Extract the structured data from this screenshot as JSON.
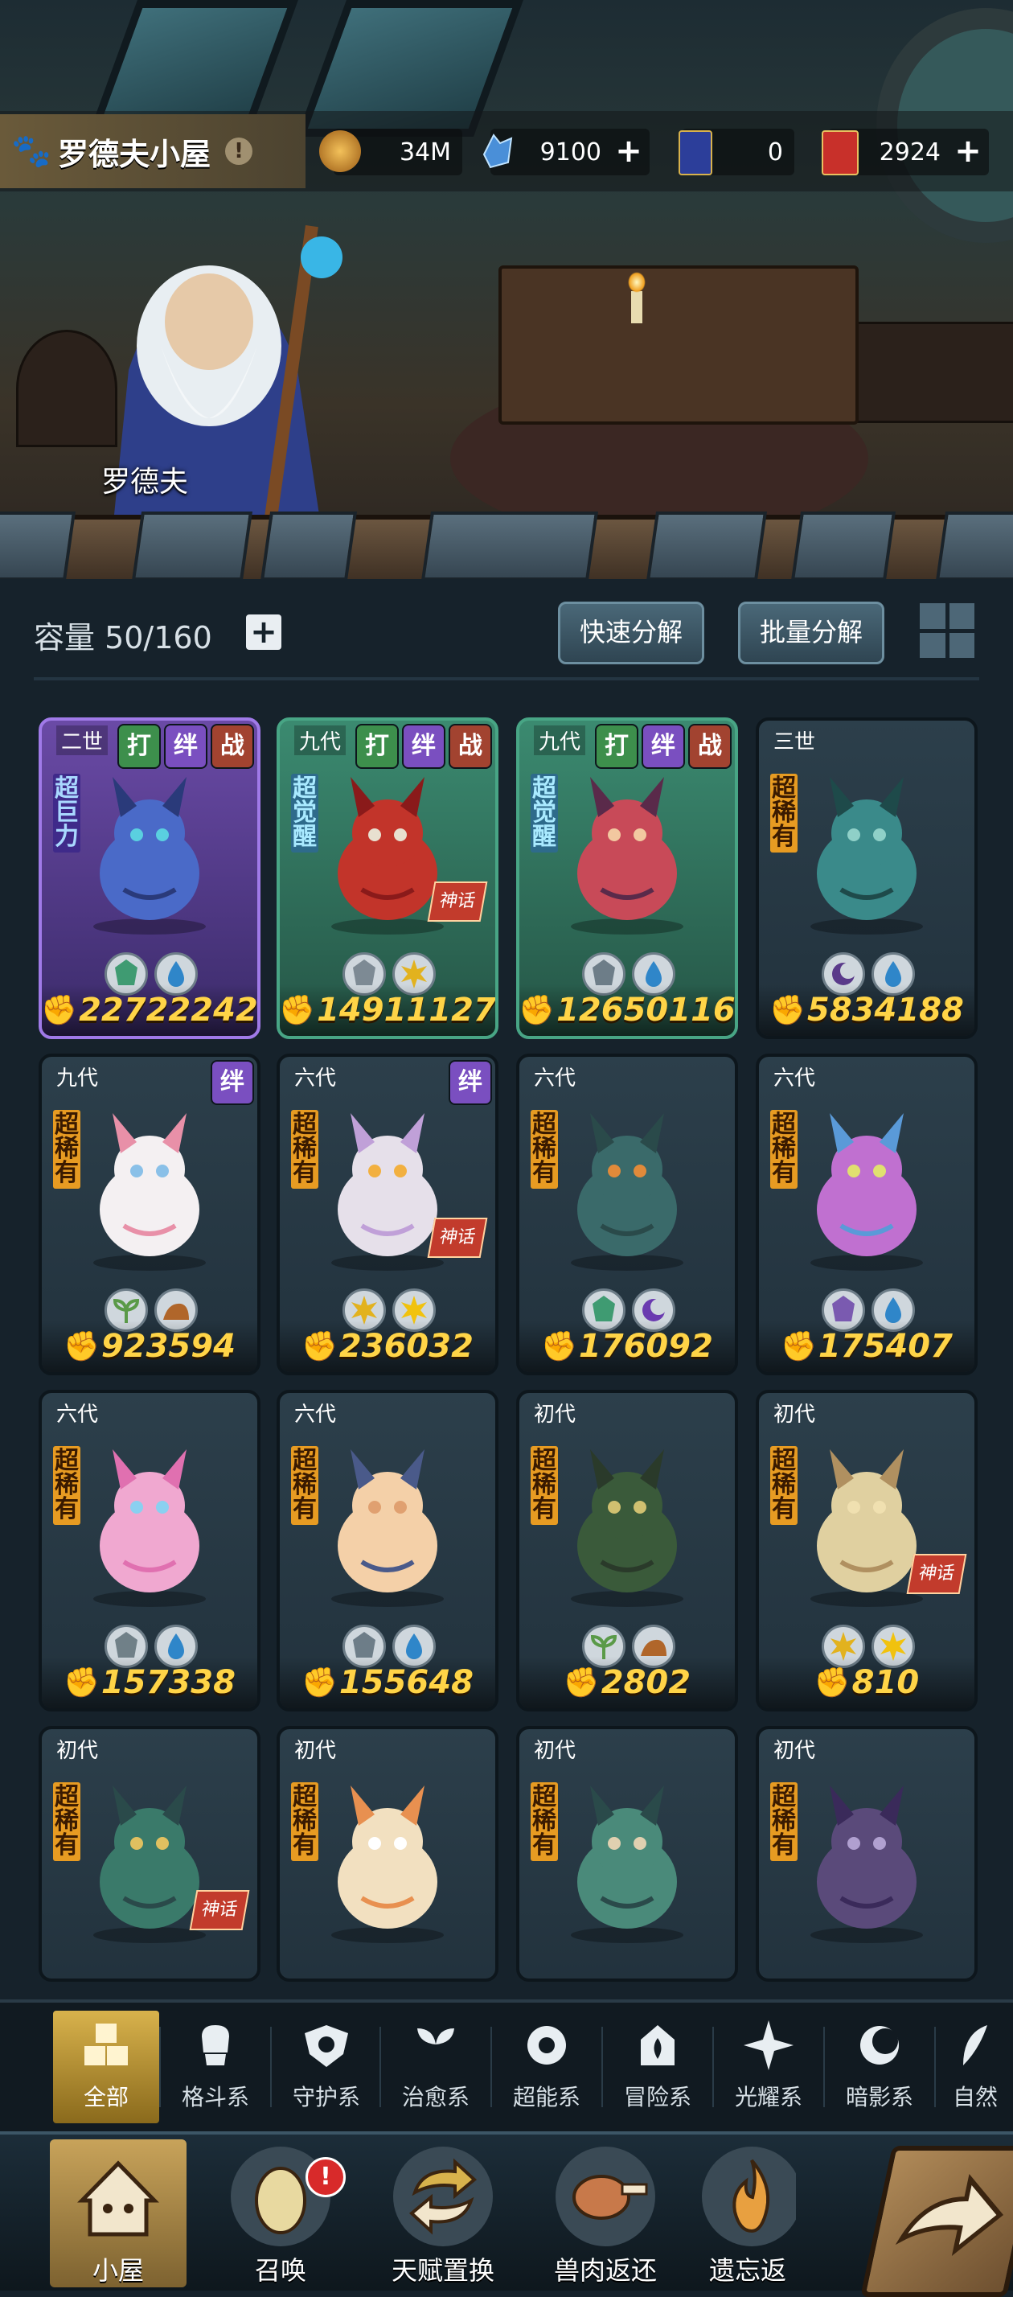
{
  "header": {
    "title": "罗德夫小屋",
    "hero_name": "罗德夫",
    "resources": [
      {
        "name": "coin",
        "value": "34M",
        "icon": "coin-icon",
        "color": "#c98a2c",
        "has_plus": false
      },
      {
        "name": "crystal",
        "value": "9100",
        "icon": "crystal-icon",
        "color": "#4a8fd8",
        "has_plus": true
      },
      {
        "name": "ticket-blue",
        "value": "0",
        "icon": "ticket-icon",
        "color": "#2c3e9a",
        "has_plus": false
      },
      {
        "name": "ticket-red",
        "value": "2924",
        "icon": "gold-ticket-icon",
        "color": "#c8302a",
        "has_plus": true
      }
    ]
  },
  "inventory": {
    "capacity_label": "容量 50/160",
    "quick_decompose": "快速分解",
    "batch_decompose": "批量分解"
  },
  "cards": [
    {
      "gen": "二世",
      "rarity": "超巨力",
      "power": "22722242",
      "style": "purple",
      "tags": [
        "打",
        "绊",
        "战"
      ],
      "elements": [
        "adventure",
        "water"
      ],
      "legend": false
    },
    {
      "gen": "九代",
      "rarity": "超觉醒",
      "power": "14911127",
      "style": "green",
      "tags": [
        "打",
        "绊",
        "战"
      ],
      "elements": [
        "fighter",
        "light"
      ],
      "legend": true
    },
    {
      "gen": "九代",
      "rarity": "超觉醒",
      "power": "12650116",
      "style": "green",
      "tags": [
        "打",
        "绊",
        "战"
      ],
      "elements": [
        "guard",
        "water"
      ],
      "legend": false
    },
    {
      "gen": "三世",
      "rarity": "超稀有",
      "power": "5834188",
      "style": "normal",
      "tags": [],
      "elements": [
        "dark",
        "water"
      ],
      "legend": false
    },
    {
      "gen": "九代",
      "rarity": "超稀有",
      "power": "923594",
      "style": "normal",
      "tags": [
        "绊"
      ],
      "elements": [
        "heal",
        "earth"
      ],
      "legend": false
    },
    {
      "gen": "六代",
      "rarity": "超稀有",
      "power": "236032",
      "style": "normal",
      "tags": [
        "绊"
      ],
      "elements": [
        "light",
        "light2"
      ],
      "legend": true
    },
    {
      "gen": "六代",
      "rarity": "超稀有",
      "power": "176092",
      "style": "normal",
      "tags": [],
      "elements": [
        "adventure",
        "dark2"
      ],
      "legend": false
    },
    {
      "gen": "六代",
      "rarity": "超稀有",
      "power": "175407",
      "style": "normal",
      "tags": [],
      "elements": [
        "psychic",
        "water"
      ],
      "legend": false
    },
    {
      "gen": "六代",
      "rarity": "超稀有",
      "power": "157338",
      "style": "normal",
      "tags": [],
      "elements": [
        "adventure2",
        "water"
      ],
      "legend": false
    },
    {
      "gen": "六代",
      "rarity": "超稀有",
      "power": "155648",
      "style": "normal",
      "tags": [],
      "elements": [
        "guard",
        "water"
      ],
      "legend": false
    },
    {
      "gen": "初代",
      "rarity": "超稀有",
      "power": "2802",
      "style": "normal",
      "tags": [],
      "elements": [
        "heal",
        "earth"
      ],
      "legend": false
    },
    {
      "gen": "初代",
      "rarity": "超稀有",
      "power": "810",
      "style": "normal",
      "tags": [],
      "elements": [
        "light",
        "light2"
      ],
      "legend": true
    },
    {
      "gen": "初代",
      "rarity": "超稀有",
      "power": "",
      "style": "normal",
      "tags": [],
      "elements": [],
      "legend": true
    },
    {
      "gen": "初代",
      "rarity": "超稀有",
      "power": "",
      "style": "normal",
      "tags": [],
      "elements": [],
      "legend": false
    },
    {
      "gen": "初代",
      "rarity": "超稀有",
      "power": "",
      "style": "normal",
      "tags": [],
      "elements": [],
      "legend": false
    },
    {
      "gen": "初代",
      "rarity": "超稀有",
      "power": "",
      "style": "normal",
      "tags": [],
      "elements": [],
      "legend": false
    }
  ],
  "legend_label": "神话",
  "tabs": [
    {
      "label": "全部",
      "icon": "all-icon"
    },
    {
      "label": "格斗系",
      "icon": "fighter-icon"
    },
    {
      "label": "守护系",
      "icon": "guard-icon"
    },
    {
      "label": "治愈系",
      "icon": "heal-icon"
    },
    {
      "label": "超能系",
      "icon": "psychic-icon"
    },
    {
      "label": "冒险系",
      "icon": "adventure-icon"
    },
    {
      "label": "光耀系",
      "icon": "light-icon"
    },
    {
      "label": "暗影系",
      "icon": "dark-icon"
    },
    {
      "label": "自然",
      "icon": "nature-icon"
    }
  ],
  "nav": [
    {
      "label": "小屋",
      "icon": "house-icon"
    },
    {
      "label": "召唤",
      "icon": "egg-icon",
      "badge": "!"
    },
    {
      "label": "天赋置换",
      "icon": "swap-icon"
    },
    {
      "label": "兽肉返还",
      "icon": "meat-icon"
    },
    {
      "label": "遗忘返",
      "icon": "flame-icon"
    }
  ],
  "colors": {
    "accent": "#ffd447",
    "background": "#16222b",
    "rarity": "#e79b22"
  }
}
